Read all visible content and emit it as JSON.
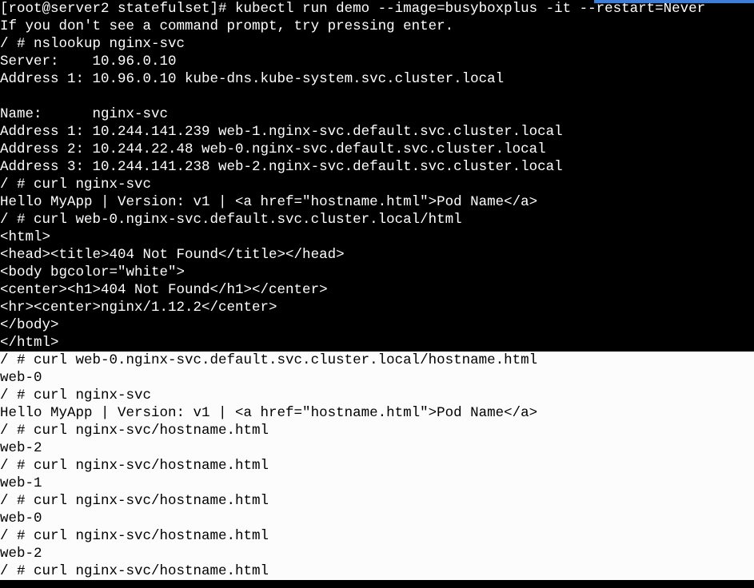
{
  "lines": [
    {
      "text": "[root@server2 statefulset]# kubectl run demo --image=busyboxplus -it --restart=Never",
      "block": "dark"
    },
    {
      "text": "If you don't see a command prompt, try pressing enter.",
      "block": "dark"
    },
    {
      "text": "/ # nslookup nginx-svc",
      "block": "dark"
    },
    {
      "text": "Server:    10.96.0.10",
      "block": "dark"
    },
    {
      "text": "Address 1: 10.96.0.10 kube-dns.kube-system.svc.cluster.local",
      "block": "dark"
    },
    {
      "text": "",
      "block": "dark"
    },
    {
      "text": "Name:      nginx-svc",
      "block": "dark"
    },
    {
      "text": "Address 1: 10.244.141.239 web-1.nginx-svc.default.svc.cluster.local",
      "block": "dark"
    },
    {
      "text": "Address 2: 10.244.22.48 web-0.nginx-svc.default.svc.cluster.local",
      "block": "dark"
    },
    {
      "text": "Address 3: 10.244.141.238 web-2.nginx-svc.default.svc.cluster.local",
      "block": "dark"
    },
    {
      "text": "/ # curl nginx-svc",
      "block": "dark"
    },
    {
      "text": "Hello MyApp | Version: v1 | <a href=\"hostname.html\">Pod Name</a>",
      "block": "dark"
    },
    {
      "text": "/ # curl web-0.nginx-svc.default.svc.cluster.local/html",
      "block": "dark"
    },
    {
      "text": "<html>",
      "block": "dark"
    },
    {
      "text": "<head><title>404 Not Found</title></head>",
      "block": "dark"
    },
    {
      "text": "<body bgcolor=\"white\">",
      "block": "dark"
    },
    {
      "text": "<center><h1>404 Not Found</h1></center>",
      "block": "dark"
    },
    {
      "text": "<hr><center>nginx/1.12.2</center>",
      "block": "dark"
    },
    {
      "text": "</body>",
      "block": "dark"
    },
    {
      "text": "</html>",
      "block": "dark"
    },
    {
      "text": "/ # curl web-0.nginx-svc.default.svc.cluster.local/hostname.html",
      "block": "light"
    },
    {
      "text": "web-0",
      "block": "light"
    },
    {
      "text": "/ # curl nginx-svc",
      "block": "light"
    },
    {
      "text": "Hello MyApp | Version: v1 | <a href=\"hostname.html\">Pod Name</a>",
      "block": "light"
    },
    {
      "text": "/ # curl nginx-svc/hostname.html",
      "block": "light"
    },
    {
      "text": "web-2",
      "block": "light"
    },
    {
      "text": "/ # curl nginx-svc/hostname.html",
      "block": "light"
    },
    {
      "text": "web-1",
      "block": "light"
    },
    {
      "text": "/ # curl nginx-svc/hostname.html",
      "block": "light"
    },
    {
      "text": "web-0",
      "block": "light"
    },
    {
      "text": "/ # curl nginx-svc/hostname.html",
      "block": "light"
    },
    {
      "text": "web-2",
      "block": "light"
    },
    {
      "text": "/ # curl nginx-svc/hostname.html",
      "block": "light"
    }
  ]
}
